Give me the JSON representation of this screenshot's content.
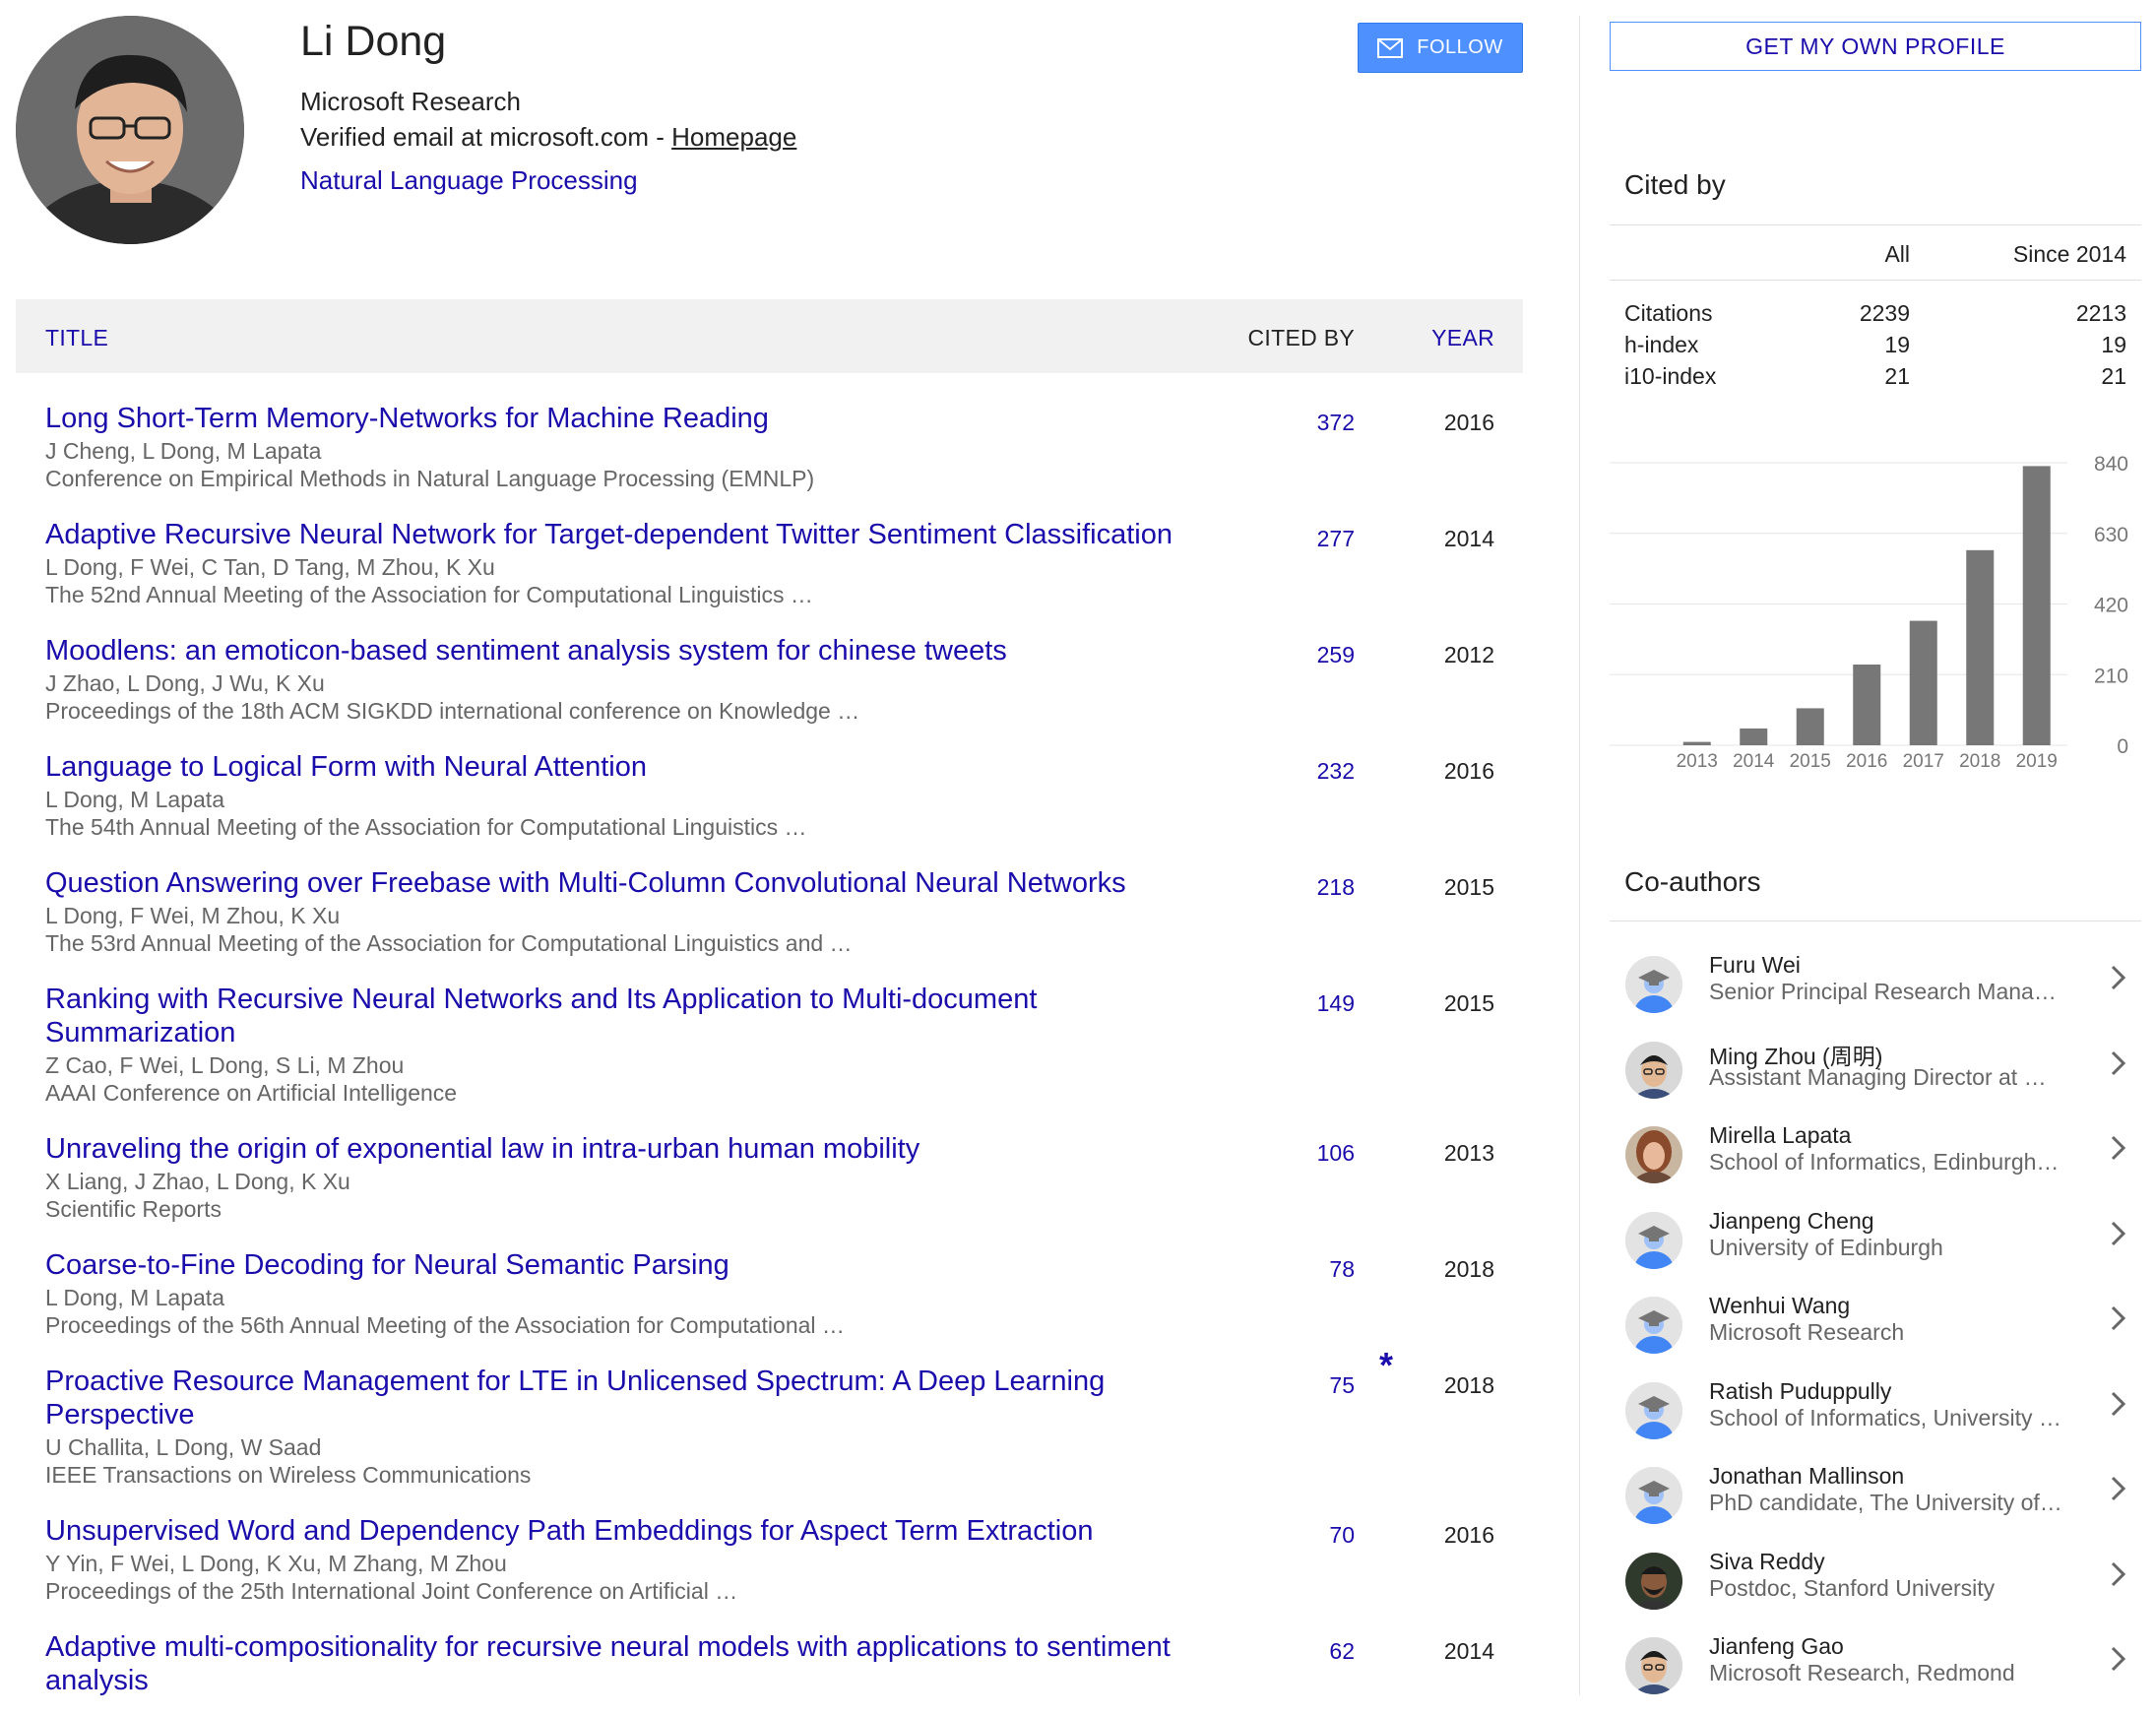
{
  "profile": {
    "name": "Li Dong",
    "affiliation": "Microsoft Research",
    "email_text": "Verified email at microsoft.com - ",
    "homepage_label": "Homepage",
    "interest": "Natural Language Processing",
    "follow_label": "FOLLOW"
  },
  "table": {
    "header_title": "TITLE",
    "header_cited": "CITED BY",
    "header_year": "YEAR",
    "rows": [
      {
        "title": "Long Short-Term Memory-Networks for Machine Reading",
        "authors": "J Cheng, L Dong, M Lapata",
        "venue": "Conference on Empirical Methods in Natural Language Processing (EMNLP)",
        "cited": "372",
        "year": "2016"
      },
      {
        "title": "Adaptive Recursive Neural Network for Target-dependent Twitter Sentiment Classification",
        "authors": "L Dong, F Wei, C Tan, D Tang, M Zhou, K Xu",
        "venue": "The 52nd Annual Meeting of the Association for Computational Linguistics …",
        "cited": "277",
        "year": "2014"
      },
      {
        "title": "Moodlens: an emoticon-based sentiment analysis system for chinese tweets",
        "authors": "J Zhao, L Dong, J Wu, K Xu",
        "venue": "Proceedings of the 18th ACM SIGKDD international conference on Knowledge …",
        "cited": "259",
        "year": "2012"
      },
      {
        "title": "Language to Logical Form with Neural Attention",
        "authors": "L Dong, M Lapata",
        "venue": "The 54th Annual Meeting of the Association for Computational Linguistics …",
        "cited": "232",
        "year": "2016"
      },
      {
        "title": "Question Answering over Freebase with Multi-Column Convolutional Neural Networks",
        "authors": "L Dong, F Wei, M Zhou, K Xu",
        "venue": "The 53rd Annual Meeting of the Association for Computational Linguistics and …",
        "cited": "218",
        "year": "2015"
      },
      {
        "title": "Ranking with Recursive Neural Networks and Its Application to Multi-document Summarization",
        "authors": "Z Cao, F Wei, L Dong, S Li, M Zhou",
        "venue": "AAAI Conference on Artificial Intelligence",
        "cited": "149",
        "year": "2015"
      },
      {
        "title": "Unraveling the origin of exponential law in intra-urban human mobility",
        "authors": "X Liang, J Zhao, L Dong, K Xu",
        "venue": "Scientific Reports",
        "cited": "106",
        "year": "2013"
      },
      {
        "title": "Coarse-to-Fine Decoding for Neural Semantic Parsing",
        "authors": "L Dong, M Lapata",
        "venue": "Proceedings of the 56th Annual Meeting of the Association for Computational …",
        "cited": "78",
        "year": "2018"
      },
      {
        "title": "Proactive Resource Management for LTE in Unlicensed Spectrum: A Deep Learning Perspective",
        "authors": "U Challita, L Dong, W Saad",
        "venue": "IEEE Transactions on Wireless Communications",
        "cited": "75",
        "year": "2018",
        "star": "*"
      },
      {
        "title": "Unsupervised Word and Dependency Path Embeddings for Aspect Term Extraction",
        "authors": "Y Yin, F Wei, L Dong, K Xu, M Zhang, M Zhou",
        "venue": "Proceedings of the 25th International Joint Conference on Artificial …",
        "cited": "70",
        "year": "2016"
      },
      {
        "title": "Adaptive multi-compositionality for recursive neural models with applications to sentiment analysis",
        "authors": "",
        "venue": "",
        "cited": "62",
        "year": "2014"
      }
    ]
  },
  "sidebar": {
    "get_profile_label": "GET MY OWN PROFILE",
    "cited_by_title": "Cited by",
    "col_all": "All",
    "col_since": "Since 2014",
    "stats": [
      {
        "label": "Citations",
        "all": "2239",
        "since": "2213"
      },
      {
        "label": "h-index",
        "all": "19",
        "since": "19"
      },
      {
        "label": "i10-index",
        "all": "21",
        "since": "21"
      }
    ],
    "coauthors_title": "Co-authors",
    "coauthors": [
      {
        "name": "Furu Wei",
        "affiliation": "Senior Principal Research Mana…",
        "avatar": "placeholder"
      },
      {
        "name": "Ming Zhou (周明)",
        "affiliation": "Assistant Managing Director at …",
        "avatar": "photo-man-glasses"
      },
      {
        "name": "Mirella Lapata",
        "affiliation": "School of Informatics, Edinburgh…",
        "avatar": "photo-woman"
      },
      {
        "name": "Jianpeng Cheng",
        "affiliation": "University of Edinburgh",
        "avatar": "placeholder"
      },
      {
        "name": "Wenhui Wang",
        "affiliation": "Microsoft Research",
        "avatar": "placeholder"
      },
      {
        "name": "Ratish Puduppully",
        "affiliation": "School of Informatics, University …",
        "avatar": "placeholder"
      },
      {
        "name": "Jonathan Mallinson",
        "affiliation": "PhD candidate, The University of…",
        "avatar": "placeholder"
      },
      {
        "name": "Siva Reddy",
        "affiliation": "Postdoc, Stanford University",
        "avatar": "photo-man-beard"
      },
      {
        "name": "Jianfeng Gao",
        "affiliation": "Microsoft Research, Redmond",
        "avatar": "photo-man-glasses"
      }
    ]
  },
  "chart_data": {
    "type": "bar",
    "categories": [
      "2013",
      "2014",
      "2015",
      "2016",
      "2017",
      "2018",
      "2019"
    ],
    "values": [
      10,
      50,
      110,
      240,
      370,
      580,
      830
    ],
    "ylim": [
      0,
      840
    ],
    "yticks": [
      "840",
      "630",
      "420",
      "210",
      "0"
    ],
    "bar_color": "#777777",
    "grid": true
  },
  "colors": {
    "link": "#1a0dab",
    "button": "#4d90fe"
  }
}
